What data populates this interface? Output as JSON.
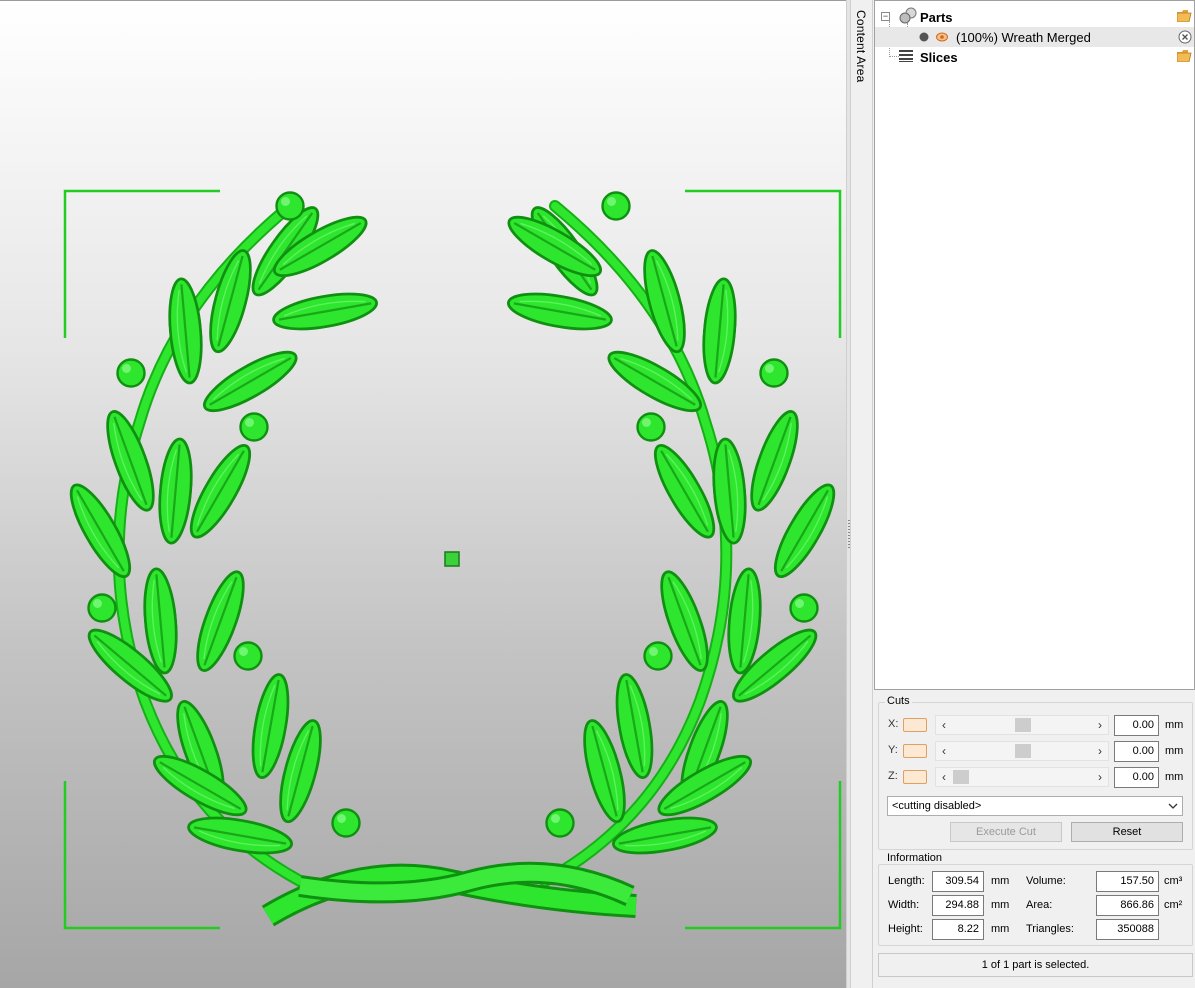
{
  "sidebar_tab": {
    "label": "Content Area"
  },
  "tree": {
    "parts_label": "Parts",
    "part_item": "(100%) Wreath Merged",
    "slices_label": "Slices"
  },
  "cuts": {
    "title": "Cuts",
    "axes": [
      {
        "label": "X:",
        "value": "0.00",
        "unit": "mm"
      },
      {
        "label": "Y:",
        "value": "0.00",
        "unit": "mm"
      },
      {
        "label": "Z:",
        "value": "0.00",
        "unit": "mm"
      }
    ],
    "mode_select": "<cutting disabled>",
    "execute_label": "Execute Cut",
    "reset_label": "Reset"
  },
  "information": {
    "title": "Information",
    "length_label": "Length:",
    "length_value": "309.54",
    "length_unit": "mm",
    "width_label": "Width:",
    "width_value": "294.88",
    "width_unit": "mm",
    "height_label": "Height:",
    "height_value": "8.22",
    "height_unit": "mm",
    "volume_label": "Volume:",
    "volume_value": "157.50",
    "volume_unit": "cm³",
    "area_label": "Area:",
    "area_value": "866.86",
    "area_unit": "cm²",
    "triangles_label": "Triangles:",
    "triangles_value": "350088"
  },
  "status": {
    "text": "1 of 1 part is selected."
  },
  "colors": {
    "model": "#22e022",
    "model_dark": "#129812",
    "bracket": "#22cc22"
  }
}
